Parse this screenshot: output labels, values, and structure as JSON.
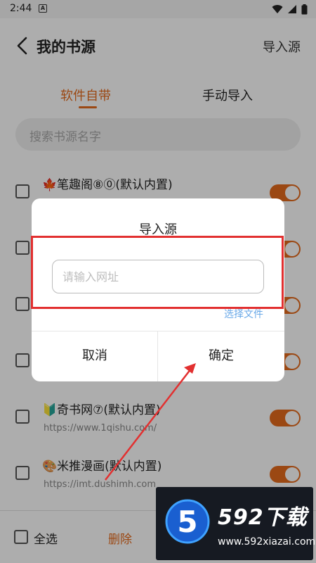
{
  "status_bar": {
    "time": "2:44",
    "app_badge": "A"
  },
  "header": {
    "title": "我的书源",
    "action": "导入源"
  },
  "tabs": [
    {
      "label": "软件自带",
      "active": true
    },
    {
      "label": "手动导入",
      "active": false
    }
  ],
  "search": {
    "placeholder": "搜索书源名字"
  },
  "sources": [
    {
      "emoji": "🍁",
      "name": "笔趣阁⑧⓪(默认内置)",
      "url": "",
      "enabled": true
    },
    {
      "emoji": "",
      "name": "",
      "url": "",
      "enabled": true
    },
    {
      "emoji": "",
      "name": "",
      "url": "",
      "enabled": true
    },
    {
      "emoji": "",
      "name": "",
      "url": "",
      "enabled": true
    },
    {
      "emoji": "🔰",
      "name": "奇书网⑦(默认内置)",
      "url": "https://www.1qishu.com/",
      "enabled": true
    },
    {
      "emoji": "🎨",
      "name": "米推漫画(默认内置)",
      "url": "https://imt.dushimh.com",
      "enabled": true
    }
  ],
  "bottom_bar": {
    "select_all": "全选",
    "delete": "删除"
  },
  "dialog": {
    "title": "导入源",
    "input_placeholder": "请输入网址",
    "input_value": "",
    "select_file": "选择文件",
    "cancel": "取消",
    "confirm": "确定"
  },
  "watermark": {
    "logo_digit": "5",
    "brand": "592下载",
    "site": "www.592xiazai.com"
  },
  "colors": {
    "accent": "#e56a1c",
    "link": "#6aa9e8",
    "annotation": "#e23030",
    "scrim": "rgba(0,0,0,0.32)"
  }
}
